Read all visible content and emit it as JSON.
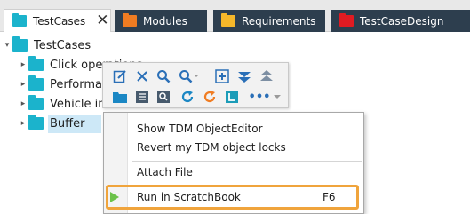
{
  "tabs": [
    {
      "label": "TestCases",
      "icon": "folder-icon",
      "color": "#1bb3cc",
      "active": true,
      "close": "✕"
    },
    {
      "label": "Modules",
      "icon": "folder-icon",
      "color": "#f07c22"
    },
    {
      "label": "Requirements",
      "icon": "folder-icon",
      "color": "#f5b72a"
    },
    {
      "label": "TestCaseDesign",
      "icon": "folder-icon",
      "color": "#e11b22"
    }
  ],
  "tree": {
    "root": {
      "label": "TestCases",
      "expand": "▾"
    },
    "items": [
      {
        "label": "Click operations",
        "expand": "▸"
      },
      {
        "label": "Performance",
        "expand": "▸"
      },
      {
        "label": "Vehicle insurance",
        "expand": "▸"
      },
      {
        "label": "Buffer",
        "expand": "▸"
      }
    ]
  },
  "toolbar": {
    "row1": [
      "edit-icon",
      "delete-icon",
      "search-icon",
      "search-dropdown-icon",
      "add-icon",
      "collapse-down-icon",
      "collapse-up-icon"
    ],
    "row2": [
      "folder-icon",
      "list-icon",
      "find-icon",
      "refresh-blue-icon",
      "refresh-orange-icon",
      "lock-icon",
      "more-icon"
    ],
    "more_label": "•••"
  },
  "context_menu": {
    "items": [
      {
        "label": "Show TDM ObjectEditor",
        "shortcut": ""
      },
      {
        "label": "Revert my TDM object locks",
        "shortcut": ""
      },
      {
        "label": "Attach File",
        "shortcut": ""
      },
      {
        "label": "Run in ScratchBook",
        "shortcut": "F6",
        "icon": "play-icon",
        "highlighted": true
      }
    ]
  },
  "colors": {
    "tab_dark": "#2d3e4e",
    "folder_teal": "#1bb3cc",
    "highlight": "#f0a43c",
    "selection": "#cde8f7",
    "play_green": "#6cc24a"
  }
}
